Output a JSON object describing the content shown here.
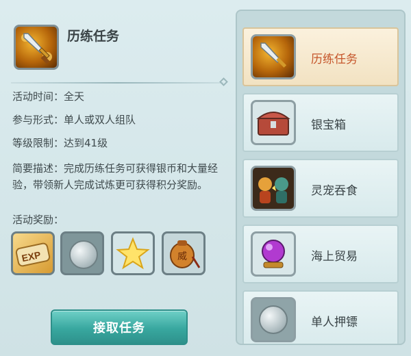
{
  "task": {
    "title": "历练任务",
    "icon": "sword-icon"
  },
  "info": {
    "time_label": "活动时间：",
    "time_value": "全天",
    "form_label": "参与形式：",
    "form_value": "单人或双人组队",
    "level_label": "等级限制：",
    "level_value": "达到41级",
    "desc_label": "简要描述：",
    "desc_value": "完成历练任务可获得银币和大量经验，带领新人完成试炼更可获得积分奖励。",
    "rewards_label": "活动奖励："
  },
  "rewards": [
    {
      "icon": "exp-scroll-icon",
      "text": "EXP"
    },
    {
      "icon": "silver-coin-icon"
    },
    {
      "icon": "star-icon"
    },
    {
      "icon": "prestige-bag-icon",
      "text": "威"
    }
  ],
  "accept_button": "接取任务",
  "activities": [
    {
      "label": "历练任务",
      "icon": "sword-icon",
      "active": true
    },
    {
      "label": "银宝箱",
      "icon": "treasure-chest-icon"
    },
    {
      "label": "灵宠吞食",
      "icon": "pet-icon"
    },
    {
      "label": "海上贸易",
      "icon": "crystal-ball-icon"
    },
    {
      "label": "单人押镖",
      "icon": "silver-coin-icon"
    }
  ],
  "colors": {
    "accent_active_text": "#c5552a",
    "button": "#38a79f"
  }
}
